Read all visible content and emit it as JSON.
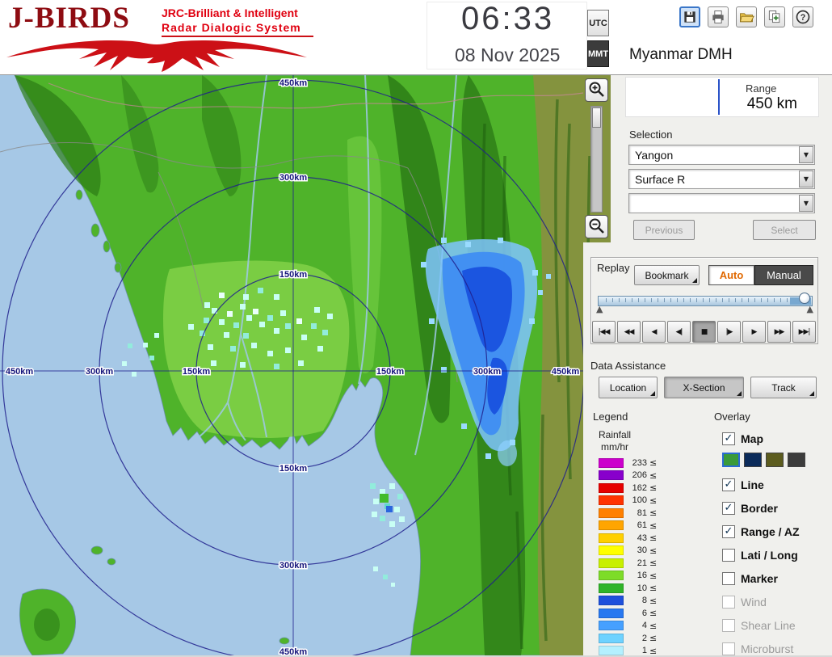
{
  "header": {
    "logo": {
      "title": "J-BIRDS",
      "subtitle1": "JRC-Brilliant & Intelligent",
      "subtitle2": "Radar  Dialogic  System"
    },
    "clock": {
      "time": "06:33",
      "date": "08 Nov 2025"
    },
    "timezone": {
      "utc": "UTC",
      "mmt": "MMT",
      "selected": "MMT"
    },
    "toolbar_icons": [
      "save",
      "print",
      "open-folder",
      "export",
      "help"
    ],
    "station": "Myanmar DMH"
  },
  "panel": {
    "range": {
      "label": "Range",
      "value": "450 km"
    },
    "selection": {
      "label": "Selection",
      "dropdowns": [
        "Yangon",
        "Surface R",
        ""
      ],
      "previous": "Previous",
      "select": "Select"
    },
    "replay": {
      "label": "Replay",
      "bookmark": "Bookmark",
      "auto": "Auto",
      "manual": "Manual",
      "mode": "Auto",
      "playback": [
        {
          "name": "jump-start",
          "glyph": "|◀◀"
        },
        {
          "name": "fast-rewind",
          "glyph": "◀◀"
        },
        {
          "name": "play-reverse",
          "glyph": "◀"
        },
        {
          "name": "step-back",
          "glyph": "◀|"
        },
        {
          "name": "stop",
          "glyph": "■",
          "active": true
        },
        {
          "name": "step-forward",
          "glyph": "|▶"
        },
        {
          "name": "play",
          "glyph": "▶"
        },
        {
          "name": "fast-forward",
          "glyph": "▶▶"
        },
        {
          "name": "jump-end",
          "glyph": "▶▶|"
        }
      ]
    },
    "data_assistance": {
      "label": "Data Assistance",
      "buttons": [
        {
          "label": "Location"
        },
        {
          "label": "X-Section",
          "pressed": true
        },
        {
          "label": "Track"
        }
      ]
    },
    "legend": {
      "label": "Legend",
      "unit_line1": "Rainfall",
      "unit_line2": "mm/hr",
      "suffix": "≤",
      "items": [
        {
          "color": "#cc00cc",
          "value": "233"
        },
        {
          "color": "#8800cc",
          "value": "206"
        },
        {
          "color": "#e60000",
          "value": "162"
        },
        {
          "color": "#ff3300",
          "value": "100"
        },
        {
          "color": "#ff8000",
          "value": "81"
        },
        {
          "color": "#ffa500",
          "value": "61"
        },
        {
          "color": "#ffd000",
          "value": "43"
        },
        {
          "color": "#ffff00",
          "value": "30"
        },
        {
          "color": "#c8f000",
          "value": "21"
        },
        {
          "color": "#7ddc28",
          "value": "16"
        },
        {
          "color": "#30b428",
          "value": "10"
        },
        {
          "color": "#1e50dc",
          "value": "8"
        },
        {
          "color": "#2878f0",
          "value": "6"
        },
        {
          "color": "#46a0ff",
          "value": "4"
        },
        {
          "color": "#6ed2ff",
          "value": "2"
        },
        {
          "color": "#b4f0ff",
          "value": "1"
        }
      ]
    },
    "overlay": {
      "label": "Overlay",
      "map_colors": [
        {
          "color": "#3a9a3a",
          "selected": true
        },
        {
          "color": "#0b2b5a"
        },
        {
          "color": "#5c5c1e"
        },
        {
          "color": "#3c3c3c"
        }
      ],
      "items": [
        {
          "label": "Map",
          "checked": true
        },
        {
          "label": "Line",
          "checked": true
        },
        {
          "label": "Border",
          "checked": true
        },
        {
          "label": "Range / AZ",
          "checked": true
        },
        {
          "label": "Lati / Long",
          "checked": false
        },
        {
          "label": "Marker",
          "checked": false
        },
        {
          "label": "Wind",
          "checked": false,
          "disabled": true
        },
        {
          "label": "Shear Line",
          "checked": false,
          "disabled": true
        },
        {
          "label": "Microburst",
          "checked": false,
          "disabled": true
        }
      ]
    }
  },
  "map": {
    "rings": [
      {
        "label": "150km",
        "km": 150
      },
      {
        "label": "300km",
        "km": 300
      },
      {
        "label": "450km",
        "km": 450
      }
    ]
  }
}
